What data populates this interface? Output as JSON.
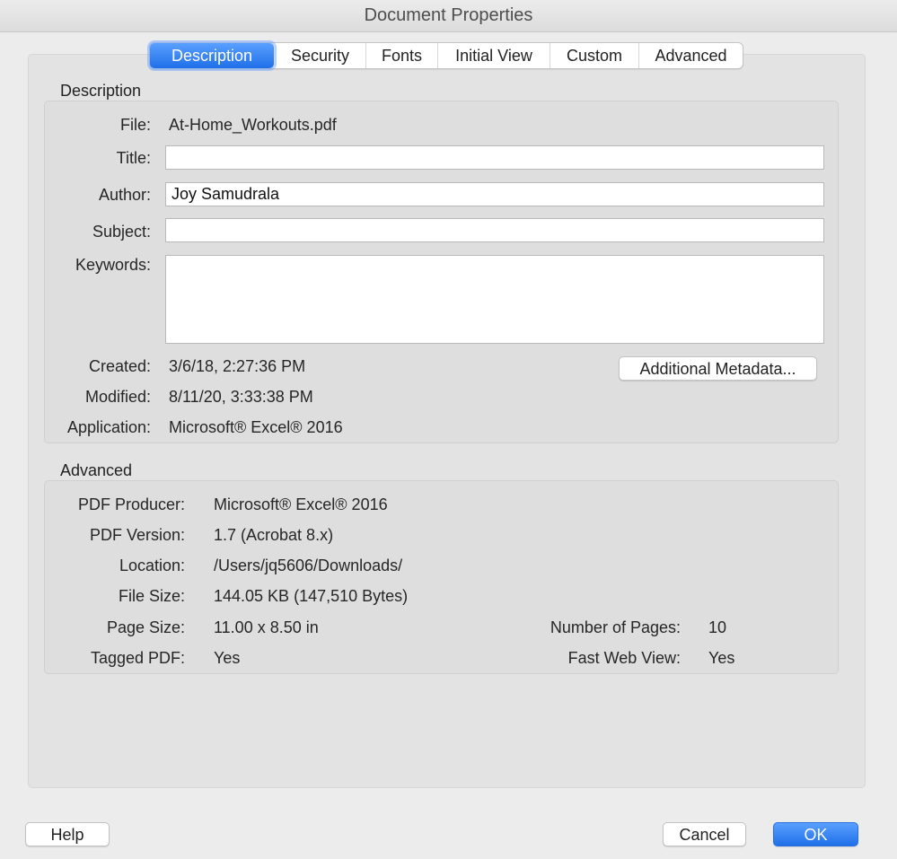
{
  "window": {
    "title": "Document Properties"
  },
  "tabs": [
    {
      "label": "Description",
      "active": true
    },
    {
      "label": "Security",
      "active": false
    },
    {
      "label": "Fonts",
      "active": false
    },
    {
      "label": "Initial View",
      "active": false
    },
    {
      "label": "Custom",
      "active": false
    },
    {
      "label": "Advanced",
      "active": false
    }
  ],
  "description": {
    "section_label": "Description",
    "file": {
      "label": "File:",
      "value": "At-Home_Workouts.pdf"
    },
    "title": {
      "label": "Title:",
      "value": ""
    },
    "author": {
      "label": "Author:",
      "value": "Joy Samudrala"
    },
    "subject": {
      "label": "Subject:",
      "value": ""
    },
    "keywords": {
      "label": "Keywords:",
      "value": ""
    },
    "created": {
      "label": "Created:",
      "value": "3/6/18, 2:27:36 PM"
    },
    "modified": {
      "label": "Modified:",
      "value": "8/11/20, 3:33:38 PM"
    },
    "application": {
      "label": "Application:",
      "value": "Microsoft® Excel® 2016"
    },
    "metadata_button": "Additional Metadata..."
  },
  "advanced": {
    "section_label": "Advanced",
    "pdf_producer": {
      "label": "PDF Producer:",
      "value": "Microsoft® Excel® 2016"
    },
    "pdf_version": {
      "label": "PDF Version:",
      "value": "1.7 (Acrobat 8.x)"
    },
    "location": {
      "label": "Location:",
      "value": "/Users/jq5606/Downloads/"
    },
    "file_size": {
      "label": "File Size:",
      "value": "144.05 KB (147,510 Bytes)"
    },
    "page_size": {
      "label": "Page Size:",
      "value": "11.00 x 8.50 in"
    },
    "num_pages": {
      "label": "Number of Pages:",
      "value": "10"
    },
    "tagged_pdf": {
      "label": "Tagged PDF:",
      "value": "Yes"
    },
    "fast_web_view": {
      "label": "Fast Web View:",
      "value": "Yes"
    }
  },
  "footer": {
    "help": "Help",
    "cancel": "Cancel",
    "ok": "OK"
  },
  "colors": {
    "accent": "#1f6fe8",
    "window_bg": "#ececec"
  }
}
